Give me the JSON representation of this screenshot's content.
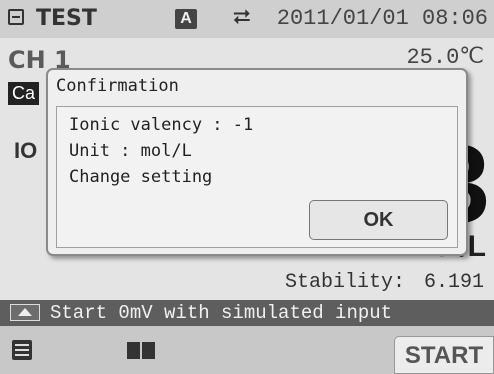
{
  "status_bar": {
    "mode": "TEST",
    "auto_badge": "A",
    "datetime": "2011/01/01 08:06",
    "icons": [
      "file-icon",
      "usb-icon"
    ]
  },
  "channel": {
    "label": "CH 1",
    "temperature": "25.0℃",
    "tag": "Ca",
    "mode_label": "IO",
    "value_partial": "3",
    "unit_partial": "mmol/L",
    "stability_label": "Stability:",
    "stability_value": "6.191"
  },
  "message_bar": {
    "icon": "eject-icon",
    "text": "Start 0mV with simulated input"
  },
  "bottom_bar": {
    "icons": [
      "list-icon",
      "book-icon"
    ],
    "start_label": "START"
  },
  "dialog": {
    "title": "Confirmation",
    "lines": [
      "Ionic valency : -1",
      "Unit : mol/L",
      "Change setting"
    ],
    "ok_label": "OK"
  },
  "colors": {
    "screen_bg": "#d9d9d9",
    "message_bar_bg": "#5e5e5e",
    "dialog_bg": "#efefef"
  }
}
